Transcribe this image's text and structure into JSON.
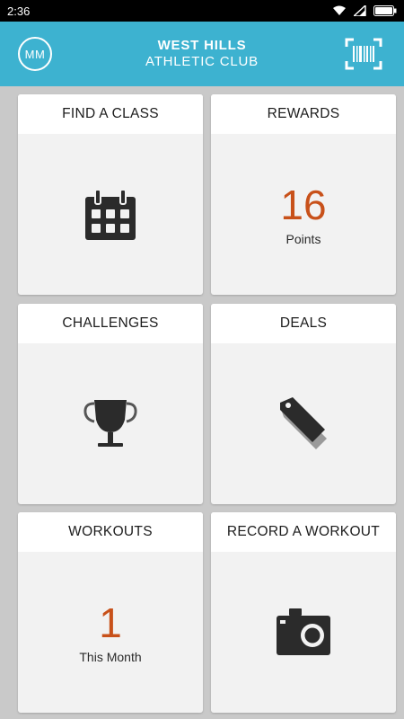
{
  "status_bar": {
    "time": "2:36",
    "icons": [
      "wifi-icon",
      "signal-icon",
      "battery-icon"
    ]
  },
  "header": {
    "avatar_initials": "MM",
    "title_line1": "WEST HILLS",
    "title_line2": "ATHLETIC CLUB",
    "right_icon": "barcode-icon"
  },
  "tiles": [
    {
      "title": "FIND A CLASS",
      "icon": "calendar-icon"
    },
    {
      "title": "REWARDS",
      "value": "16",
      "label": "Points"
    },
    {
      "title": "CHALLENGES",
      "icon": "trophy-icon"
    },
    {
      "title": "DEALS",
      "icon": "tag-icon"
    },
    {
      "title": "WORKOUTS",
      "value": "1",
      "label": "This Month"
    },
    {
      "title": "RECORD A WORKOUT",
      "icon": "camera-icon"
    }
  ],
  "colors": {
    "header_bg": "#3db2d0",
    "accent_number": "#c8511a",
    "background": "#c9c9c9",
    "tile_bg": "#f2f2f2",
    "icon": "#2b2b2b"
  }
}
